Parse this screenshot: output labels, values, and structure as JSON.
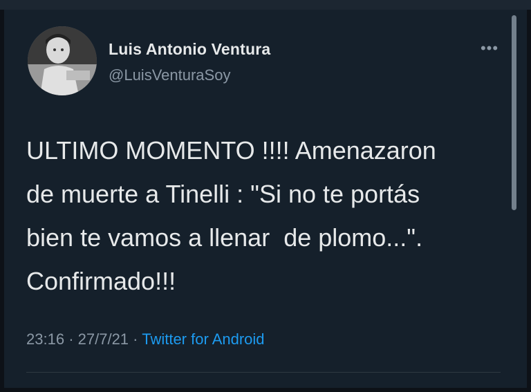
{
  "author": {
    "name": "Luis Antonio Ventura",
    "handle": "@LuisVenturaSoy"
  },
  "tweet": {
    "text": "ULTIMO MOMENTO !!!! Amenazaron\nde muerte a Tinelli : \"Si no te portás\nbien te vamos a llenar  de plomo...\".\nConfirmado!!!",
    "time": "23:16",
    "separator": "·",
    "date": "27/7/21",
    "source": "Twitter for Android"
  },
  "icons": {
    "more": "more-horizontal-icon"
  },
  "colors": {
    "background": "#15202b",
    "text": "#e7e9ea",
    "secondary": "#8b98a5",
    "link": "#1d9bf0"
  }
}
